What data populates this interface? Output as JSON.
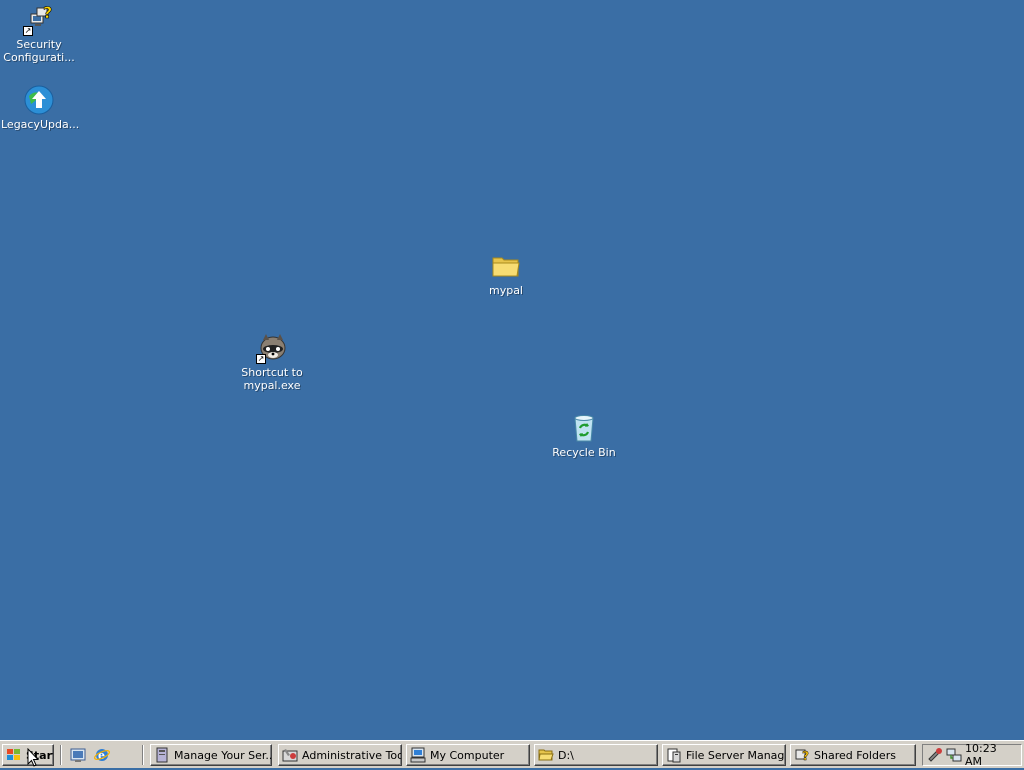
{
  "desktop": {
    "background": "#3a6ea5",
    "icons": [
      {
        "label": "Security Configurati...",
        "icon": "security-config-icon"
      },
      {
        "label": "LegacyUpda...",
        "icon": "legacy-update-icon"
      },
      {
        "label": "mypal",
        "icon": "folder-icon"
      },
      {
        "label": "Shortcut to mypal.exe",
        "icon": "mypal-raccoon-icon"
      },
      {
        "label": "Recycle Bin",
        "icon": "recycle-bin-icon"
      }
    ]
  },
  "taskbar": {
    "start_label": "Start",
    "quick_launch": [
      "show-desktop-icon",
      "internet-explorer-icon"
    ],
    "buttons": [
      {
        "label": "Manage Your Ser...",
        "icon": "manage-server-icon"
      },
      {
        "label": "Administrative Tools",
        "icon": "admin-tools-icon"
      },
      {
        "label": "My Computer",
        "icon": "my-computer-icon"
      },
      {
        "label": "D:\\",
        "icon": "folder-open-icon"
      },
      {
        "label": "File Server Manag...",
        "icon": "file-server-icon"
      },
      {
        "label": "Shared Folders",
        "icon": "shared-folders-icon"
      }
    ],
    "clock": "10:23 AM"
  }
}
